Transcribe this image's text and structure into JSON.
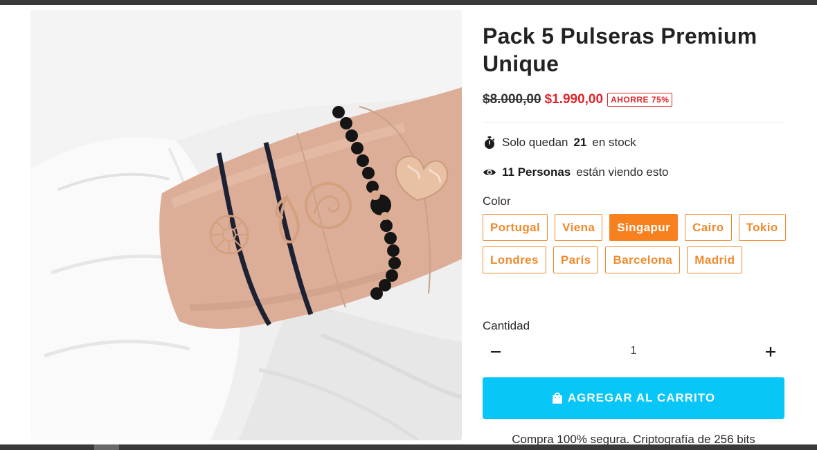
{
  "product": {
    "title": "Pack 5 Pulseras Premium Unique",
    "price_old": "$8.000,00",
    "price_new": "$1.990,00",
    "save_badge": "AHORRE 75%"
  },
  "stock": {
    "prefix": "Solo quedan",
    "count": "21",
    "suffix": "en stock"
  },
  "viewers": {
    "count_label": "11 Personas",
    "suffix": "están viendo esto"
  },
  "variants": {
    "label": "Color",
    "options": [
      "Portugal",
      "Viena",
      "Singapur",
      "Cairo",
      "Tokio",
      "Londres",
      "París",
      "Barcelona",
      "Madrid"
    ],
    "selected": "Singapur"
  },
  "quantity": {
    "label": "Cantidad",
    "value": "1",
    "minus_symbol": "−",
    "plus_symbol": "+"
  },
  "cart": {
    "button_label": "AGREGAR AL CARRITO"
  },
  "secure_text": "Compra 100% segura. Criptografía de 256 bits",
  "icons": {
    "stock": "stopwatch-icon",
    "viewers": "eye-icon",
    "cart": "shopping-bag-icon"
  },
  "colors": {
    "accent_orange": "#f7801f",
    "sale_red": "#e0242b",
    "cart_blue": "#08c6f7"
  }
}
